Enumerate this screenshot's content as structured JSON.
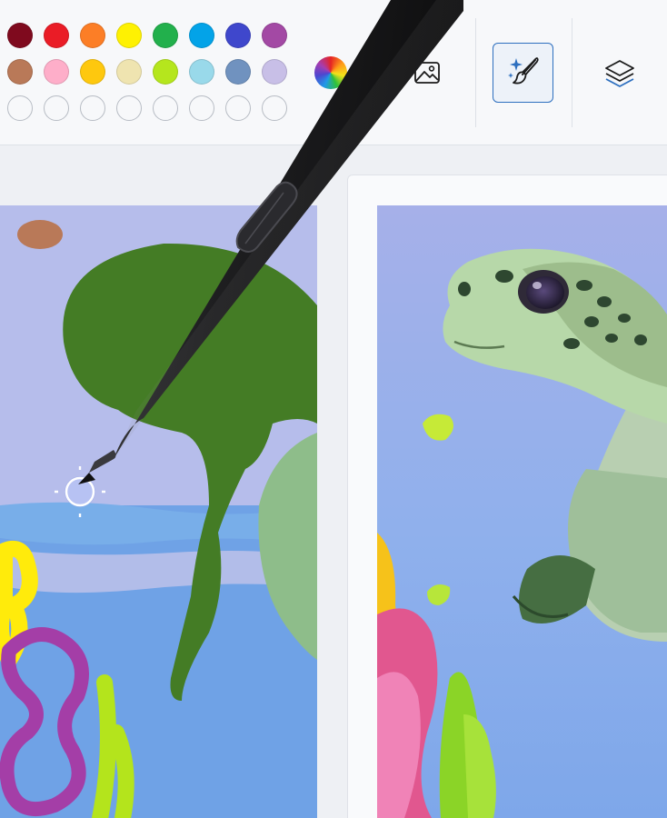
{
  "palette": {
    "row1": [
      "#7f0a1e",
      "#ea1c26",
      "#fc7e26",
      "#fef102",
      "#22b04c",
      "#03a3e8",
      "#3f47cc",
      "#a349a4"
    ],
    "row2": [
      "#b97958",
      "#feaec9",
      "#fec80e",
      "#efe4b0",
      "#b5e61d",
      "#99d9ea",
      "#7092bf",
      "#c8bfe7"
    ],
    "empty_count": 8
  },
  "colors": {
    "toolbar_bg": "#f7f8fa",
    "app_bg": "#eef0f4",
    "accent": "#2d6fbf",
    "pen_body": "#1e1e20"
  },
  "tools": {
    "color_picker_icon": "rainbow-color-wheel-icon",
    "image_icon": "image-icon",
    "cocreator_icon": "sparkle-brush-icon",
    "layers_icon": "layers-icon"
  }
}
